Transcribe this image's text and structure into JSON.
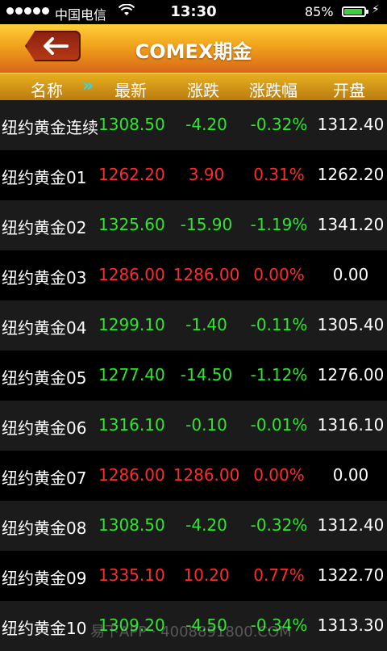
{
  "status_bar": {
    "carrier": "中国电信",
    "time": "13:30",
    "battery": "85%"
  },
  "header": {
    "title": "COMEX期金"
  },
  "columns": {
    "name": "名称",
    "latest": "最新",
    "change": "涨跌",
    "change_pct": "涨跌幅",
    "open": "开盘"
  },
  "rows": [
    {
      "name": "纽约黄金连续",
      "latest": "1308.50",
      "change": "-4.20",
      "pct": "-0.32%",
      "open": "1312.40",
      "trend": "down"
    },
    {
      "name": "纽约黄金01",
      "latest": "1262.20",
      "change": "3.90",
      "pct": "0.31%",
      "open": "1262.20",
      "trend": "up"
    },
    {
      "name": "纽约黄金02",
      "latest": "1325.60",
      "change": "-15.90",
      "pct": "-1.19%",
      "open": "1341.20",
      "trend": "down"
    },
    {
      "name": "纽约黄金03",
      "latest": "1286.00",
      "change": "1286.00",
      "pct": "0.00%",
      "open": "0.00",
      "trend": "up"
    },
    {
      "name": "纽约黄金04",
      "latest": "1299.10",
      "change": "-1.40",
      "pct": "-0.11%",
      "open": "1305.40",
      "trend": "down"
    },
    {
      "name": "纽约黄金05",
      "latest": "1277.40",
      "change": "-14.50",
      "pct": "-1.12%",
      "open": "1276.00",
      "trend": "down"
    },
    {
      "name": "纽约黄金06",
      "latest": "1316.10",
      "change": "-0.10",
      "pct": "-0.01%",
      "open": "1316.10",
      "trend": "down"
    },
    {
      "name": "纽约黄金07",
      "latest": "1286.00",
      "change": "1286.00",
      "pct": "0.00%",
      "open": "0.00",
      "trend": "up"
    },
    {
      "name": "纽约黄金08",
      "latest": "1308.50",
      "change": "-4.20",
      "pct": "-0.32%",
      "open": "1312.40",
      "trend": "down"
    },
    {
      "name": "纽约黄金09",
      "latest": "1335.10",
      "change": "10.20",
      "pct": "0.77%",
      "open": "1322.70",
      "trend": "up"
    },
    {
      "name": "纽约黄金10",
      "latest": "1309.20",
      "change": "-4.50",
      "pct": "-0.34%",
      "open": "1313.30",
      "trend": "down"
    }
  ],
  "watermark": "易下APP · 4008891800.COM",
  "colors": {
    "up": "#ff2a2a",
    "down": "#2ce62c",
    "header_top": "#ffcf3a",
    "header_bottom": "#d9661a"
  },
  "icons": [
    "signal-icon",
    "wifi-icon",
    "battery-icon",
    "back-arrow-icon",
    "double-chevron-right-icon"
  ]
}
